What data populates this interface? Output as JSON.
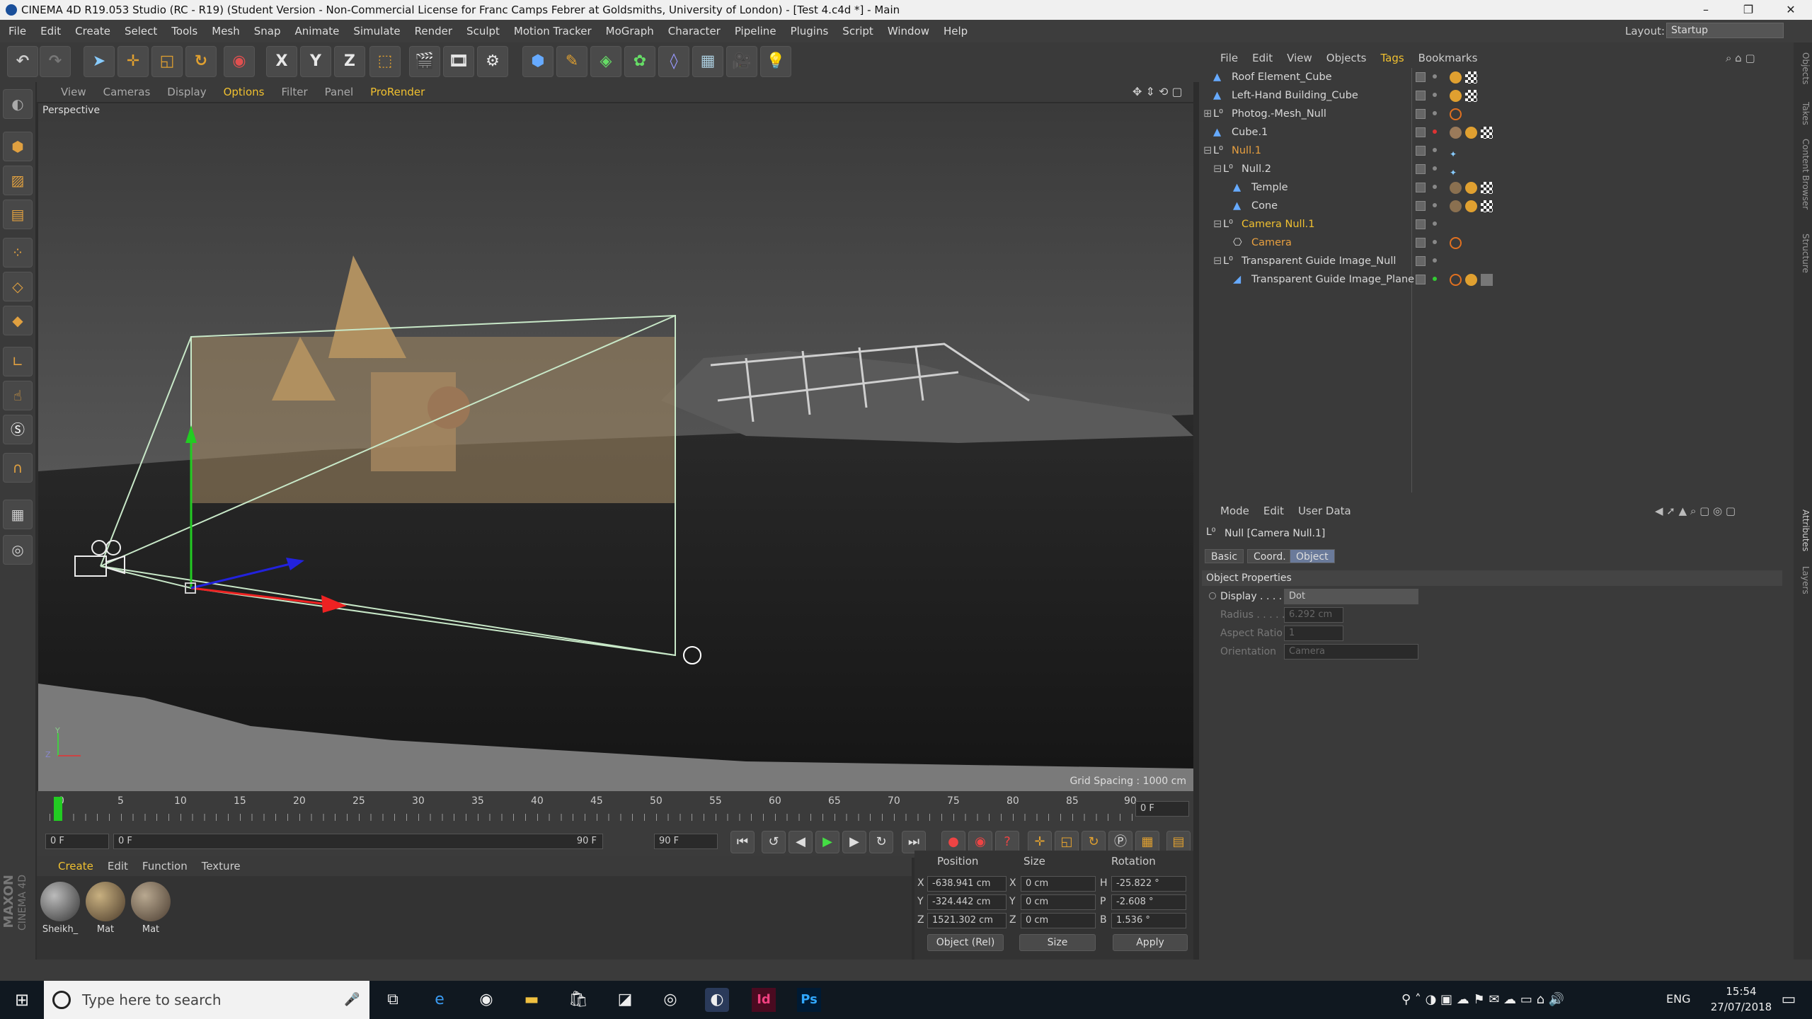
{
  "titlebar": {
    "title": "CINEMA 4D R19.053 Studio (RC - R19) (Student Version - Non-Commercial License for Franc Camps Febrer at Goldsmiths, University of London) - [Test 4.c4d *] - Main",
    "minimize": "–",
    "restore": "❐",
    "close": "✕"
  },
  "menu": [
    "File",
    "Edit",
    "Create",
    "Select",
    "Tools",
    "Mesh",
    "Snap",
    "Animate",
    "Simulate",
    "Render",
    "Sculpt",
    "Motion Tracker",
    "MoGraph",
    "Character",
    "Pipeline",
    "Plugins",
    "Script",
    "Window",
    "Help"
  ],
  "layout": {
    "label": "Layout:",
    "value": "Startup"
  },
  "toolbar": {
    "x": "X",
    "y": "Y",
    "z": "Z"
  },
  "viewport": {
    "menu": [
      "View",
      "Cameras",
      "Display",
      "Options",
      "Filter",
      "Panel",
      "ProRender"
    ],
    "label": "Perspective",
    "grid_spacing": "Grid Spacing : 1000 cm",
    "axis_y": "Y",
    "axis_z": "Z"
  },
  "timeline": {
    "ticks": [
      "0",
      "5",
      "10",
      "15",
      "20",
      "25",
      "30",
      "35",
      "40",
      "45",
      "50",
      "55",
      "60",
      "65",
      "70",
      "75",
      "80",
      "85",
      "90"
    ],
    "current": "0 F",
    "start": "0 F",
    "min": "0 F",
    "max": "90 F",
    "end": "90 F"
  },
  "materials": {
    "menu": [
      "Create",
      "Edit",
      "Function",
      "Texture"
    ],
    "items": [
      {
        "name": "Sheikh_",
        "color": "#555"
      },
      {
        "name": "Mat",
        "color": "#8a7a60"
      },
      {
        "name": "Mat",
        "color": "#7a6c60"
      }
    ]
  },
  "coords": {
    "headers": {
      "position": "Position",
      "size": "Size",
      "rotation": "Rotation"
    },
    "rows": [
      {
        "axis": "X",
        "pos": "-638.941 cm",
        "saxis": "X",
        "size": "0 cm",
        "raxis": "H",
        "rot": "-25.822 °"
      },
      {
        "axis": "Y",
        "pos": "-324.442 cm",
        "saxis": "Y",
        "size": "0 cm",
        "raxis": "P",
        "rot": "-2.608 °"
      },
      {
        "axis": "Z",
        "pos": "1521.302 cm",
        "saxis": "Z",
        "size": "0 cm",
        "raxis": "B",
        "rot": "1.536 °"
      }
    ],
    "mode": "Object (Rel)",
    "sizemode": "Size",
    "apply": "Apply"
  },
  "brand": {
    "maxon": "MAXON",
    "cinema": "CINEMA 4D"
  },
  "objects": {
    "menu": [
      "File",
      "Edit",
      "View",
      "Objects",
      "Tags",
      "Bookmarks"
    ],
    "rows": [
      {
        "name": "Roof Element_Cube",
        "indent": 0,
        "color": "#d8d8d8"
      },
      {
        "name": "Left-Hand Building_Cube",
        "indent": 0,
        "color": "#d8d8d8"
      },
      {
        "name": "Photog.-Mesh_Null",
        "indent": 0,
        "color": "#d8d8d8"
      },
      {
        "name": "Cube.1",
        "indent": 0,
        "color": "#d8d8d8"
      },
      {
        "name": "Null.1",
        "indent": 0,
        "color": "#e8a040"
      },
      {
        "name": "Null.2",
        "indent": 1,
        "color": "#d8d8d8"
      },
      {
        "name": "Temple",
        "indent": 2,
        "color": "#d8d8d8"
      },
      {
        "name": "Cone",
        "indent": 2,
        "color": "#d8d8d8"
      },
      {
        "name": "Camera Null.1",
        "indent": 1,
        "color": "#f0c030"
      },
      {
        "name": "Camera",
        "indent": 2,
        "color": "#e8a040"
      },
      {
        "name": "Transparent Guide Image_Null",
        "indent": 1,
        "color": "#d8d8d8"
      },
      {
        "name": "Transparent Guide Image_Plane",
        "indent": 2,
        "color": "#d8d8d8"
      }
    ]
  },
  "attributes": {
    "menu": [
      "Mode",
      "Edit",
      "User Data"
    ],
    "title": "Null [Camera Null.1]",
    "tabs": [
      "Basic",
      "Coord.",
      "Object"
    ],
    "section": "Object Properties",
    "props": [
      {
        "label": "Display . . . .",
        "value": "Dot"
      },
      {
        "label": "Radius . . . . .",
        "value": "6.292 cm"
      },
      {
        "label": "Aspect Ratio",
        "value": "1"
      },
      {
        "label": "Orientation",
        "value": "Camera"
      }
    ]
  },
  "rightstrip": [
    "Objects",
    "Takes",
    "Content Browser",
    "Structure",
    "Attributes",
    "Layers"
  ],
  "taskbar": {
    "search": "Type here to search",
    "lang": "ENG",
    "time": "15:54",
    "date": "27/07/2018"
  }
}
